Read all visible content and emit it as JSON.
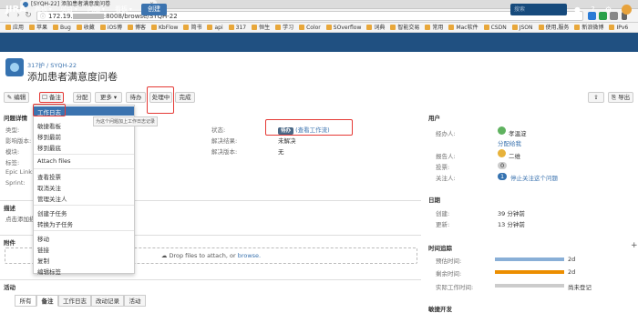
{
  "browser": {
    "tab_title": "[SYQH-22] 添加患者满意度问卷",
    "url": "172.19.",
    "url_path": ":8008/browse/SYQH-22",
    "bookmarks": [
      "应用",
      "苹果",
      "Bug",
      "收藏",
      "iOS博",
      "博客",
      "KbFlow",
      "简书",
      "api",
      "317",
      "恒生",
      "学习",
      "Color",
      "SOverflow",
      "词典",
      "智能交易",
      "常用",
      "Mac软件",
      "CSDN",
      "JSON",
      "使用,服务",
      "新浪微博",
      "IPv6"
    ]
  },
  "jira": {
    "logo": "JIRA",
    "menus": [
      "面板",
      "项目",
      "问题",
      "看板"
    ],
    "create": "创建",
    "search_placeholder": "搜索"
  },
  "issue": {
    "project": "317护",
    "key": "SYQH-22",
    "title": "添加患者满意度问卷"
  },
  "toolbar": {
    "edit": "编辑",
    "comment": "备注",
    "assign": "分配",
    "more": "更多",
    "todo": "待办",
    "in_progress": "处理中",
    "done": "完成",
    "export": "导出"
  },
  "details": {
    "heading": "问题详情",
    "labels": [
      "类型:",
      "影响版本:",
      "模块:",
      "标签:",
      "Epic Link:",
      "Sprint:"
    ],
    "status_label": "状态:",
    "status_value": "待办",
    "status_link": "(查看工作流)",
    "resolution_label": "解决结果:",
    "resolution_value": "未解决",
    "fixver_label": "解决版本:",
    "fixver_value": "无"
  },
  "dropdown": {
    "items1": [
      "工作日志",
      "敏捷看板",
      "移到最前",
      "移到最底"
    ],
    "items2": [
      "Attach files"
    ],
    "items3": [
      "查看投票",
      "取消关注",
      "管理关注人"
    ],
    "items4": [
      "创建子任务",
      "转换为子任务"
    ],
    "items5": [
      "移动",
      "链接",
      "复制",
      "编辑标签"
    ],
    "tooltip": "为这个问题加上工作日志记录"
  },
  "description": {
    "heading": "描述",
    "placeholder": "点击添加描述"
  },
  "attachments": {
    "heading": "附件",
    "drop_text": "Drop files to attach, or",
    "browse": "browse."
  },
  "activity": {
    "heading": "活动",
    "tabs": [
      "所有",
      "备注",
      "工作日志",
      "改动记录",
      "活动"
    ]
  },
  "people": {
    "heading": "用户",
    "assignee_label": "经办人:",
    "assignee": "孝温淀",
    "assign_to_me": "分配给我",
    "reporter_label": "报告人:",
    "reporter": "二维",
    "votes_label": "投票:",
    "votes": "0",
    "watchers_label": "关注人:",
    "watchers": "1",
    "stop_watching": "停止关注这个问题"
  },
  "dates": {
    "heading": "日期",
    "created_label": "创建:",
    "created": "39 分钟前",
    "updated_label": "更新:",
    "updated": "13 分钟前"
  },
  "time_tracking": {
    "heading": "时间追踪",
    "estimated_label": "预估时间:",
    "estimated": "2d",
    "remaining_label": "剩余时间:",
    "remaining": "2d",
    "logged_label": "实际工作时间:",
    "logged": "尚未登记",
    "colors": {
      "estimated": "#89afd7",
      "remaining": "#ec8e00",
      "logged": "#51a825"
    }
  },
  "agile": {
    "heading": "敏捷开发"
  }
}
